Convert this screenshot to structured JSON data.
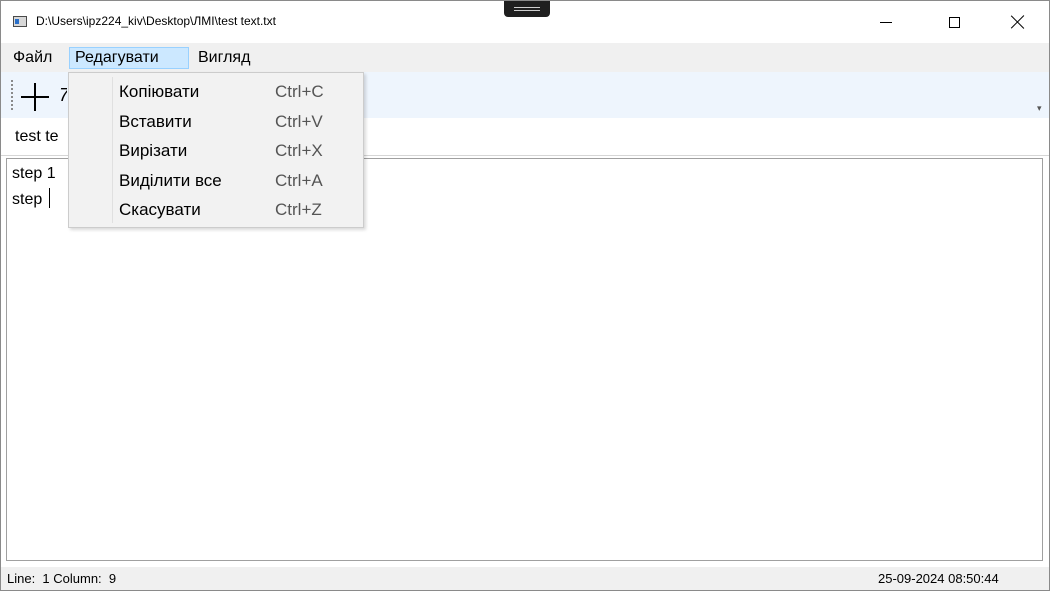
{
  "window": {
    "title": "D:\\Users\\ipz224_kiv\\Desktop\\ЛМІ\\test text.txt"
  },
  "menubar": {
    "items": [
      {
        "label": "Файл"
      },
      {
        "label": "Редагувати"
      },
      {
        "label": "Вигляд"
      }
    ]
  },
  "toolbar": {
    "partial_label": "7"
  },
  "tabs": [
    {
      "label": "test te"
    }
  ],
  "editor": {
    "lines": [
      "step 1",
      "step "
    ]
  },
  "edit_menu": {
    "items": [
      {
        "label": "Копіювати",
        "shortcut": "Ctrl+C"
      },
      {
        "label": "Вставити",
        "shortcut": "Ctrl+V"
      },
      {
        "label": "Вирізати",
        "shortcut": "Ctrl+X"
      },
      {
        "label": "Виділити все",
        "shortcut": "Ctrl+A"
      },
      {
        "label": "Скасувати",
        "shortcut": "Ctrl+Z"
      }
    ]
  },
  "statusbar": {
    "position": "Line:  1 Column:  9",
    "datetime": "25-09-2024 08:50:44"
  },
  "colors": {
    "menu_highlight": "#cce8ff",
    "toolbar_bg": "#eef5fd",
    "menu_bg": "#f0f0f0"
  }
}
